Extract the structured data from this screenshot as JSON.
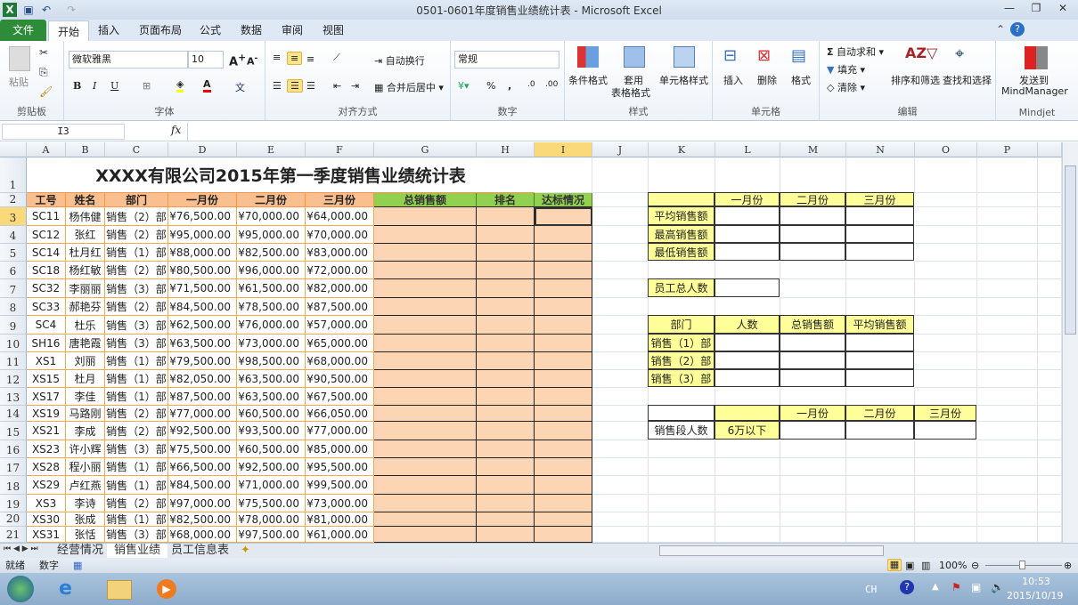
{
  "window": {
    "title": "0501-0601年度销售业绩统计表 - Microsoft Excel"
  },
  "tabs": [
    {
      "label": "文件"
    },
    {
      "label": "开始"
    },
    {
      "label": "插入"
    },
    {
      "label": "页面布局"
    },
    {
      "label": "公式"
    },
    {
      "label": "数据"
    },
    {
      "label": "审阅"
    },
    {
      "label": "视图"
    }
  ],
  "ribbon": {
    "clipboard": {
      "label": "剪贴板",
      "paste": "粘贴"
    },
    "font": {
      "label": "字体",
      "name": "微软雅黑",
      "size": "10",
      "bold": "B",
      "italic": "I",
      "underline": "U"
    },
    "align": {
      "label": "对齐方式",
      "wrap": "自动换行",
      "merge": "合并后居中"
    },
    "number": {
      "label": "数字",
      "format": "常规",
      "percent": "%",
      "comma": ","
    },
    "styles": {
      "label": "样式",
      "cond": "条件格式",
      "table1": "套用",
      "table2": "表格格式",
      "cell": "单元格样式"
    },
    "cells": {
      "label": "单元格",
      "insert": "插入",
      "delete": "删除",
      "format": "格式"
    },
    "edit": {
      "label": "编辑",
      "autosum": "自动求和",
      "fill": "填充",
      "clear": "清除",
      "sort": "排序和筛选",
      "find": "查找和选择"
    },
    "mindjet": {
      "label": "Mindjet",
      "send1": "发送到",
      "send2": "MindManager"
    }
  },
  "formula_bar": {
    "name_box": "I3",
    "fx": "fx",
    "value": ""
  },
  "columns": [
    "A",
    "B",
    "C",
    "D",
    "E",
    "F",
    "G",
    "H",
    "I",
    "J",
    "K",
    "L",
    "M",
    "N",
    "O",
    "P"
  ],
  "sheet": {
    "title": "XXXX有限公司2015年第一季度销售业绩统计表",
    "headers": [
      "工号",
      "姓名",
      "部门",
      "一月份",
      "二月份",
      "三月份",
      "总销售额",
      "排名",
      "达标情况"
    ],
    "rows": [
      [
        "SC11",
        "杨伟健",
        "销售（2）部",
        "¥76,500.00",
        "¥70,000.00",
        "¥64,000.00"
      ],
      [
        "SC12",
        "张红",
        "销售（2）部",
        "¥95,000.00",
        "¥95,000.00",
        "¥70,000.00"
      ],
      [
        "SC14",
        "杜月红",
        "销售（1）部",
        "¥88,000.00",
        "¥82,500.00",
        "¥83,000.00"
      ],
      [
        "SC18",
        "杨红敏",
        "销售（2）部",
        "¥80,500.00",
        "¥96,000.00",
        "¥72,000.00"
      ],
      [
        "SC32",
        "李丽丽",
        "销售（3）部",
        "¥71,500.00",
        "¥61,500.00",
        "¥82,000.00"
      ],
      [
        "SC33",
        "郝艳芬",
        "销售（2）部",
        "¥84,500.00",
        "¥78,500.00",
        "¥87,500.00"
      ],
      [
        "SC4",
        "杜乐",
        "销售（3）部",
        "¥62,500.00",
        "¥76,000.00",
        "¥57,000.00"
      ],
      [
        "SH16",
        "唐艳霞",
        "销售（3）部",
        "¥63,500.00",
        "¥73,000.00",
        "¥65,000.00"
      ],
      [
        "XS1",
        "刘丽",
        "销售（1）部",
        "¥79,500.00",
        "¥98,500.00",
        "¥68,000.00"
      ],
      [
        "XS15",
        "杜月",
        "销售（1）部",
        "¥82,050.00",
        "¥63,500.00",
        "¥90,500.00"
      ],
      [
        "XS17",
        "李佳",
        "销售（1）部",
        "¥87,500.00",
        "¥63,500.00",
        "¥67,500.00"
      ],
      [
        "XS19",
        "马路刚",
        "销售（2）部",
        "¥77,000.00",
        "¥60,500.00",
        "¥66,050.00"
      ],
      [
        "XS21",
        "李成",
        "销售（2）部",
        "¥92,500.00",
        "¥93,500.00",
        "¥77,000.00"
      ],
      [
        "XS23",
        "许小辉",
        "销售（3）部",
        "¥75,500.00",
        "¥60,500.00",
        "¥85,000.00"
      ],
      [
        "XS28",
        "程小丽",
        "销售（1）部",
        "¥66,500.00",
        "¥92,500.00",
        "¥95,500.00"
      ],
      [
        "XS29",
        "卢红燕",
        "销售（1）部",
        "¥84,500.00",
        "¥71,000.00",
        "¥99,500.00"
      ],
      [
        "XS3",
        "李诗",
        "销售（2）部",
        "¥97,000.00",
        "¥75,500.00",
        "¥73,000.00"
      ],
      [
        "XS30",
        "张成",
        "销售（1）部",
        "¥82,500.00",
        "¥78,000.00",
        "¥81,000.00"
      ],
      [
        "XS31",
        "张恬",
        "销售（3）部",
        "¥68,000.00",
        "¥97,500.00",
        "¥61,000.00"
      ]
    ],
    "stats": {
      "months": [
        "一月份",
        "二月份",
        "三月份"
      ],
      "labels": [
        "平均销售额",
        "最高销售额",
        "最低销售额"
      ]
    },
    "headcount": {
      "label": "员工总人数"
    },
    "dept": {
      "headers": [
        "部门",
        "人数",
        "总销售额",
        "平均销售额"
      ],
      "names": [
        "销售（1）部",
        "销售（2）部",
        "销售（3）部"
      ]
    },
    "band": {
      "months": [
        "一月份",
        "二月份",
        "三月份"
      ],
      "label": "销售段人数",
      "range": "6万以下"
    }
  },
  "sheet_tabs": [
    {
      "label": "经营情况"
    },
    {
      "label": "销售业绩"
    },
    {
      "label": "员工信息表"
    }
  ],
  "status": {
    "ready": "就绪",
    "mode": "数字",
    "zoom": "100%"
  },
  "taskbar": {
    "lang": "CH",
    "time": "10:53",
    "date": "2015/10/19"
  }
}
